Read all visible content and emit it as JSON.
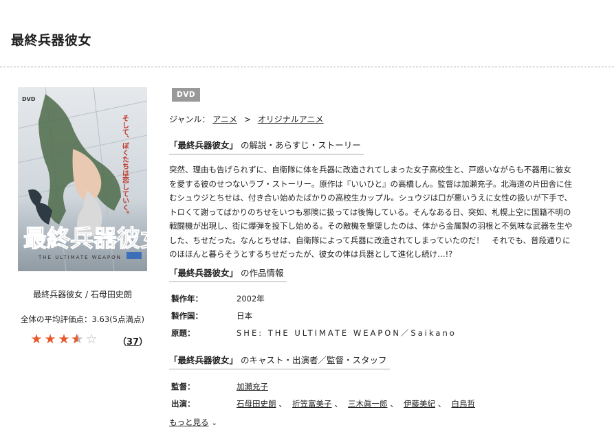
{
  "header": {
    "title": "最終兵器彼女"
  },
  "cover": {
    "label": "DVD",
    "title_art": "最終兵器彼女",
    "subtitle_art": "THE ULTIMATE WEAPON",
    "vertical_text": "そして、ぼくたちは恋していく。",
    "caption": "最終兵器彼女 / 石母田史朗"
  },
  "rating": {
    "text": "全体の平均評価点：3.63(5点満点)",
    "value": 3.63,
    "max": 5,
    "count": "37",
    "count_open": "（",
    "count_close": "）",
    "colors": {
      "fill": "#e8572c",
      "empty": "#bbbbbb"
    }
  },
  "badge": "DVD",
  "genre": {
    "label": "ジャンル：",
    "items": [
      "アニメ",
      "オリジナルアニメ"
    ],
    "separator": ">"
  },
  "sections": {
    "synopsis_title": "「最終兵器彼女」",
    "synopsis_rest": "の解説・あらすじ・ストーリー",
    "info_title": "「最終兵器彼女」",
    "info_rest": "の作品情報",
    "cast_title": "「最終兵器彼女」",
    "cast_rest": "のキャスト・出演者／監督・スタッフ"
  },
  "synopsis": {
    "lines": [
      "突然、理由も告げられずに、自衛隊に体を兵器に改造されてしまった女子高校生と、戸惑いながらも不器用に彼女",
      "を愛する彼のせつないラブ・ストーリー。原作は『いいひと』の高橋しん。監督は加瀬充子。北海道の片田舎に住",
      "むシュウジとちせは、付き合い始めたばかりの高校生カップル。シュウジは口が悪いうえに女性の扱いが下手で、",
      "トロくて謝ってばかりのちせをいつも邪険に扱っては後悔している。そんなある日、突如、札幌上空に国籍不明の",
      "戦闘機が出現し、街に爆弾を投下し始める。その敵機を撃墜したのは、体から金属製の羽根と不気味な武器を生や",
      "した、ちせだった。なんとちせは、自衛隊によって兵器に改造されてしまっていたのだ！　それでも、普段通りに",
      "のほほんと暮らそうとするちせだったが、彼女の体は兵器として進化し続け…!?"
    ]
  },
  "info": [
    {
      "key": "製作年：",
      "value": "2002年"
    },
    {
      "key": "製作国：",
      "value": "日本"
    },
    {
      "key": "原題：",
      "value": "SHE: THE ULTIMATE WEAPON／Saikano"
    }
  ],
  "staff": {
    "director_label": "監督：",
    "director": "加瀬充子",
    "cast_label": "出演：",
    "cast": [
      "石母田史朗",
      "折笠富美子",
      "三木眞一郎",
      "伊藤美紀",
      "白鳥哲"
    ],
    "cast_sep": "、",
    "more": "もっと見る",
    "more_icon": "chevron-down-icon"
  }
}
